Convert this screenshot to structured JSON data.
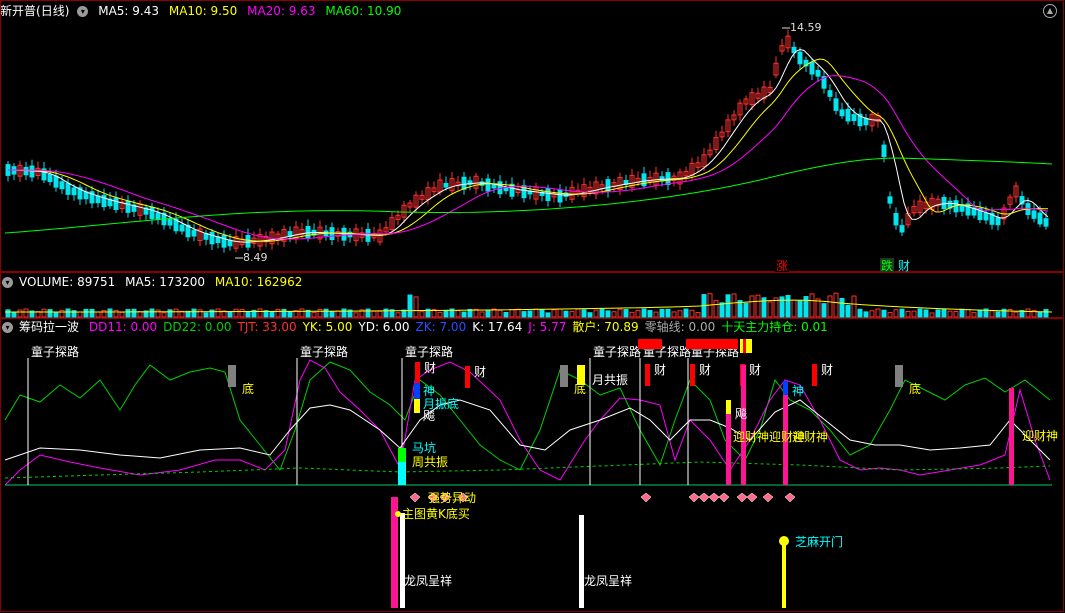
{
  "colors": {
    "up": "#ff3030",
    "down": "#00e5ee",
    "ma5": "#ffffff",
    "ma10": "#ffff00",
    "ma20": "#ff00ff",
    "ma60": "#00ff00",
    "grid": "#8b0000",
    "dd22": "#00d000",
    "pink": "#ff1493",
    "yellow": "#ffff00",
    "cyan": "#00ffff",
    "red": "#ff0000",
    "gray": "#808080"
  },
  "price_panel": {
    "stock_name": "新开普",
    "period": "(日线)",
    "ma_label": [
      "MA5:",
      "MA10:",
      "MA20:",
      "MA60:"
    ],
    "ma_value": [
      "9.43",
      "9.50",
      "9.63",
      "10.90"
    ],
    "high_label": "14.59",
    "low_label": "8.49",
    "badges": [
      "涨",
      "跌",
      "财"
    ]
  },
  "volume_panel": {
    "labels": [
      "VOLUME:",
      "MA5:",
      "MA10:"
    ],
    "values": [
      "89751",
      "173200",
      "162962"
    ]
  },
  "indicator_panel": {
    "name": "筹码拉一波",
    "items": [
      {
        "label": "DD11:",
        "value": "0.00",
        "color": "#ff00ff"
      },
      {
        "label": "DD22:",
        "value": "0.00",
        "color": "#00d000"
      },
      {
        "label": "TJT:",
        "value": "33.00",
        "color": "#ff3030"
      },
      {
        "label": "YK:",
        "value": "5.00",
        "color": "#ffff00"
      },
      {
        "label": "YD:",
        "value": "6.00",
        "color": "#ffffff"
      },
      {
        "label": "ZK:",
        "value": "7.00",
        "color": "#2a4fff"
      },
      {
        "label": "K:",
        "value": "17.64",
        "color": "#ffffff"
      },
      {
        "label": "J:",
        "value": "5.77",
        "color": "#ff00ff"
      },
      {
        "label": "散户:",
        "value": "70.89",
        "color": "#ffff00"
      },
      {
        "label": "零轴线:",
        "value": "0.00",
        "color": "#aaaaaa"
      },
      {
        "label": "十天主力持仓:",
        "value": "0.01",
        "color": "#00ff00"
      }
    ],
    "signals": {
      "tongzi": "童子探路",
      "di": "底",
      "cai": "财",
      "shen": "神",
      "yuezhendi": "月振底",
      "biao": "飚",
      "yuegongzhen": "月共振",
      "makeng": "马坑",
      "zhougongzhen": "周共振",
      "qiangshi": "强势异动",
      "zhutu": "主图黄K底买",
      "zhimakaimen": "芝麻开门",
      "longfeng": "龙凤呈祥",
      "yingcaishen": "迎财神"
    }
  }
}
